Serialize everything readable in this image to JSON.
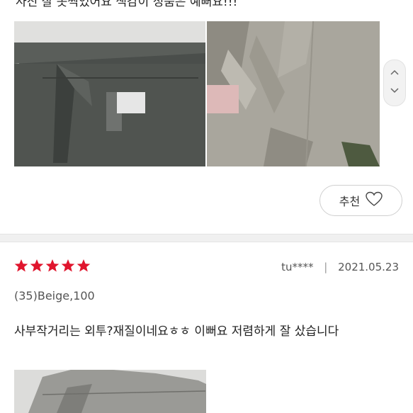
{
  "review_prev": {
    "text": "사진 잘 못찍었어요 색감이 정품은 예뻐요!!!",
    "recommend_label": "추천"
  },
  "review": {
    "rating": 5,
    "author": "tu****",
    "date": "2021.05.23",
    "option": "(35)Beige,100",
    "text": "사부작거리는 외투?재질이네요ㅎㅎ 이뻐요 저렴하게 잘 샀습니다"
  },
  "colors": {
    "star": "#e0152d",
    "divider": "#f0f0f0"
  },
  "icons": {
    "scroll_up": "chevron-up-icon",
    "scroll_down": "chevron-down-icon",
    "recommend": "heart-outline-icon"
  }
}
